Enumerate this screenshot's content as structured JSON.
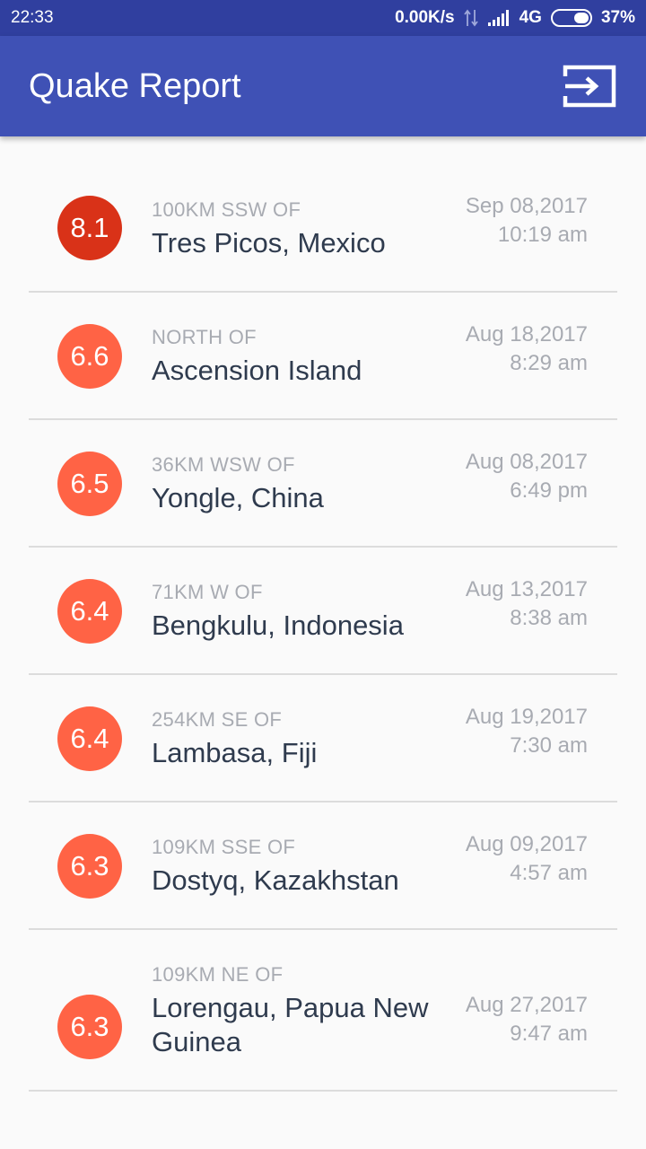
{
  "status_bar": {
    "time": "22:33",
    "net_speed": "0.00K/s",
    "network": "4G",
    "battery": "37%"
  },
  "app_bar": {
    "title": "Quake Report",
    "action_icon": "exit-to-app-icon"
  },
  "colors": {
    "status_bar": "#303f9f",
    "app_bar": "#3f51b5",
    "mag_8": "#d93218",
    "mag_6": "#ff6345"
  },
  "earthquakes": [
    {
      "magnitude": "8.1",
      "offset": "100KM SSW OF",
      "place": "Tres Picos, Mexico",
      "date": "Sep 08,2017",
      "time": "10:19 am",
      "color": "#d93218"
    },
    {
      "magnitude": "6.6",
      "offset": "NORTH OF",
      "place": "Ascension Island",
      "date": "Aug 18,2017",
      "time": "8:29 am",
      "color": "#ff6345"
    },
    {
      "magnitude": "6.5",
      "offset": "36KM WSW OF",
      "place": "Yongle, China",
      "date": "Aug 08,2017",
      "time": "6:49 pm",
      "color": "#ff6345"
    },
    {
      "magnitude": "6.4",
      "offset": "71KM W OF",
      "place": "Bengkulu, Indonesia",
      "date": "Aug 13,2017",
      "time": "8:38 am",
      "color": "#ff6345"
    },
    {
      "magnitude": "6.4",
      "offset": "254KM SE OF",
      "place": "Lambasa, Fiji",
      "date": "Aug 19,2017",
      "time": "7:30 am",
      "color": "#ff6345"
    },
    {
      "magnitude": "6.3",
      "offset": "109KM SSE OF",
      "place": "Dostyq, Kazakhstan",
      "date": "Aug 09,2017",
      "time": "4:57 am",
      "color": "#ff6345"
    },
    {
      "magnitude": "6.3",
      "offset": "109KM NE OF",
      "place": "Lorengau, Papua New Guinea",
      "date": "Aug 27,2017",
      "time": "9:47 am",
      "color": "#ff6345"
    }
  ]
}
